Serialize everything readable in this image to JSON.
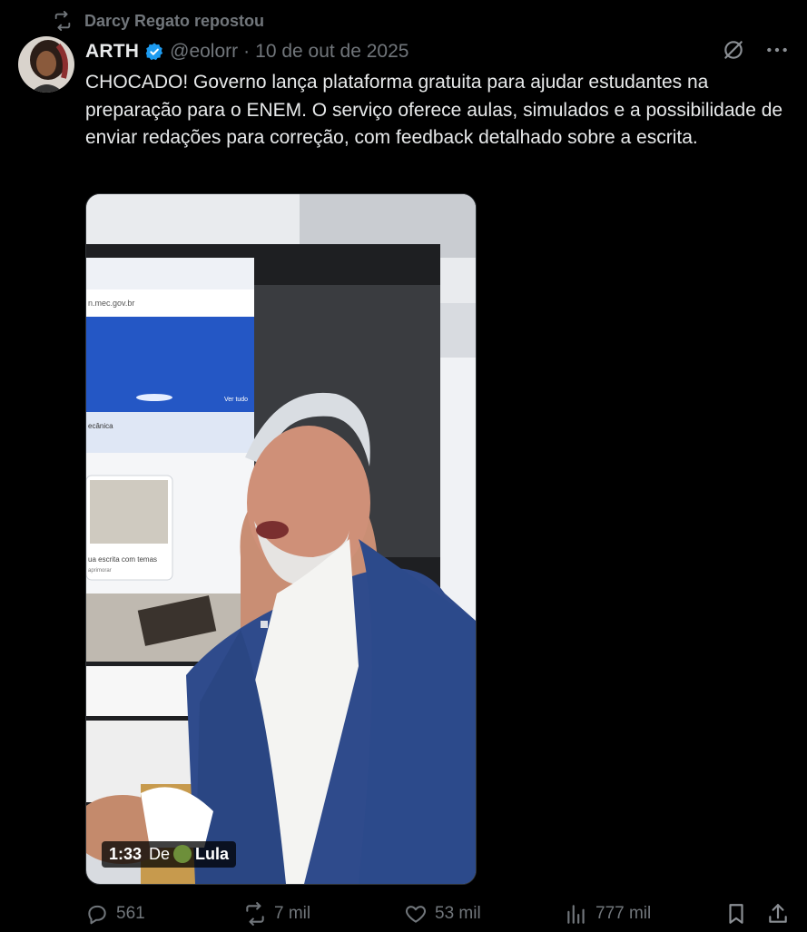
{
  "repost": {
    "text": "Darcy Regato repostou"
  },
  "author": {
    "name": "ARTH",
    "handle": "@eolorr",
    "separator": "·",
    "date": "10 de out de 2025"
  },
  "tweet": {
    "text": "CHOCADO! Governo lança plataforma gratuita para ajudar estudantes na preparação para o ENEM. O serviço oferece aulas, simulados e a possibilidade de enviar redações para correção, com feedback detalhado sobre a escrita."
  },
  "video": {
    "duration": "1:33",
    "from_prefix": "De",
    "from_name": "Lula",
    "screen_texts": {
      "url": "n.mec.gov.br",
      "side": "Ver tudo",
      "tab": "ecânica",
      "card": "ua escrita com temas",
      "card_sub": "aprimorar"
    }
  },
  "stats": {
    "replies": "561",
    "reposts": "7 mil",
    "likes": "53 mil",
    "views": "777 mil"
  },
  "colors": {
    "background": "#000000",
    "text": "#e7e9ea",
    "muted": "#71767b",
    "verified": "#1d9bf0"
  },
  "icons": [
    "repost-icon",
    "verified-icon",
    "grok-icon",
    "more-icon",
    "reply-icon",
    "like-icon",
    "views-icon",
    "bookmark-icon",
    "share-icon"
  ]
}
